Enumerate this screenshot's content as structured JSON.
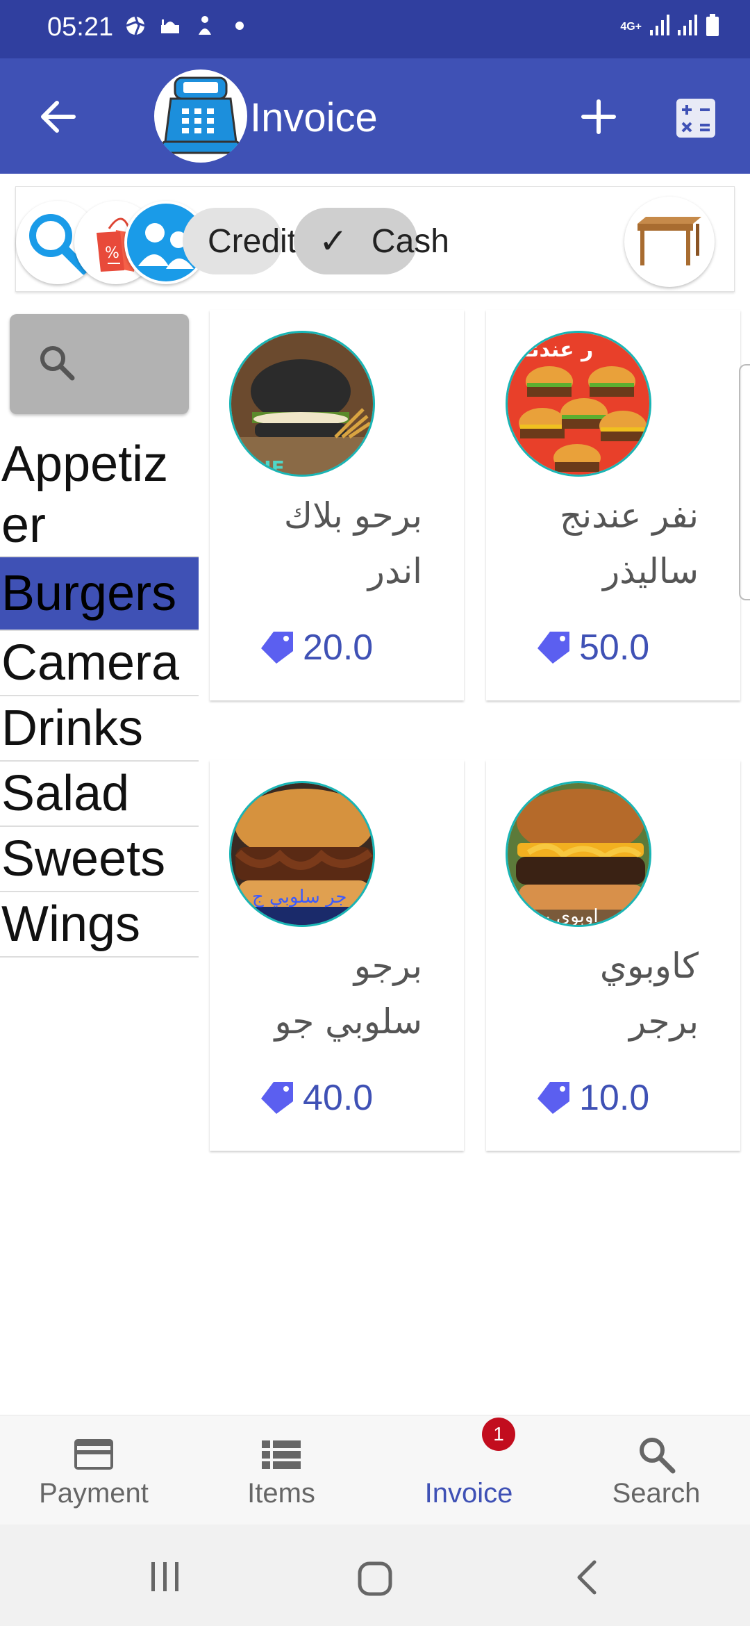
{
  "status_bar": {
    "time": "05:21",
    "network": "4G+",
    "icons": [
      "aperture-icon",
      "mosque-icon",
      "figure-icon",
      "dot-icon",
      "signal-icon",
      "battery-icon"
    ]
  },
  "app_bar": {
    "title": "Invoice",
    "accent_color": "#3f51b5",
    "status_color": "#303f9f"
  },
  "filters": {
    "credit_label": "Credit",
    "cash_label": "Cash",
    "cash_selected": true,
    "check_glyph": "✓"
  },
  "categories": [
    {
      "label": "Appetizer",
      "line1": "Appetiz",
      "line2": "er"
    },
    {
      "label": "Burgers",
      "selected": true
    },
    {
      "label": "Camera"
    },
    {
      "label": "Drinks"
    },
    {
      "label": "Salad"
    },
    {
      "label": "Sweets"
    },
    {
      "label": "Wings"
    }
  ],
  "products": [
    {
      "line1": "برحو بلاك",
      "line2": "اندر",
      "price": "20.0",
      "image_overlay": "LUE"
    },
    {
      "line1": "نفر عندنج",
      "line2": "ساليذر",
      "price": "50.0",
      "image_overlay": "ر عندنـ"
    },
    {
      "line1": "برجو",
      "line2": "سلوبي جو",
      "price": "40.0",
      "image_overlay": "جر سلوبي ج"
    },
    {
      "line1": "كاوبوي",
      "line2": "برجر",
      "price": "10.0",
      "image_overlay": "اوبوي بر"
    }
  ],
  "bottom_nav": [
    {
      "label": "Payment",
      "icon": "credit-card-icon"
    },
    {
      "label": "Items",
      "icon": "list-icon"
    },
    {
      "label": "Invoice",
      "icon": "invoice-icon",
      "active": true,
      "badge": "1"
    },
    {
      "label": "Search",
      "icon": "search-icon"
    }
  ]
}
